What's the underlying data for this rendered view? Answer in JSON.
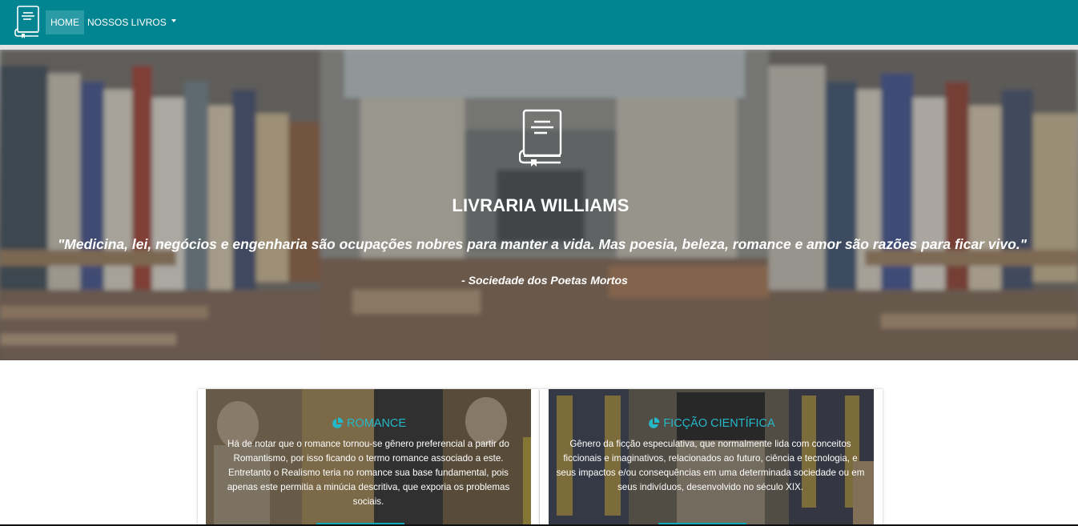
{
  "navbar": {
    "brand_icon": "book-icon",
    "home_label": "HOME",
    "books_label": "NOSSOS LIVROS",
    "accent_color": "#038591"
  },
  "hero": {
    "icon": "book-icon",
    "title": "LIVRARIA WILLIAMS",
    "quote": "\"Medicina, lei, negócios e engenharia são ocupações nobres para manter a vida. Mas poesia, beleza, romance e amor são razões para ficar vivo.\"",
    "author": "- Sociedade dos Poetas Mortos"
  },
  "cards": [
    {
      "icon": "pie-chart-icon",
      "title": "ROMANCE",
      "text": "Há de notar que o romance tornou-se gênero preferencial a partir do Romantismo, por isso ficando o termo romance associado a este. Entretanto o Realismo teria no romance sua base fundamental, pois apenas este permitia a minúcia descritiva, que exporia os problemas sociais."
    },
    {
      "icon": "pie-chart-icon",
      "title": "FICÇÃO CIENTÍFICA",
      "text": "Gênero da ficção especulativa, que normalmente lida com conceitos ficcionais e imaginativos, relacionados ao futuro, ciência e tecnologia, e seus impactos e/ou consequências em uma determinada sociedade ou em seus indivíduos, desenvolvido no século XIX."
    }
  ]
}
